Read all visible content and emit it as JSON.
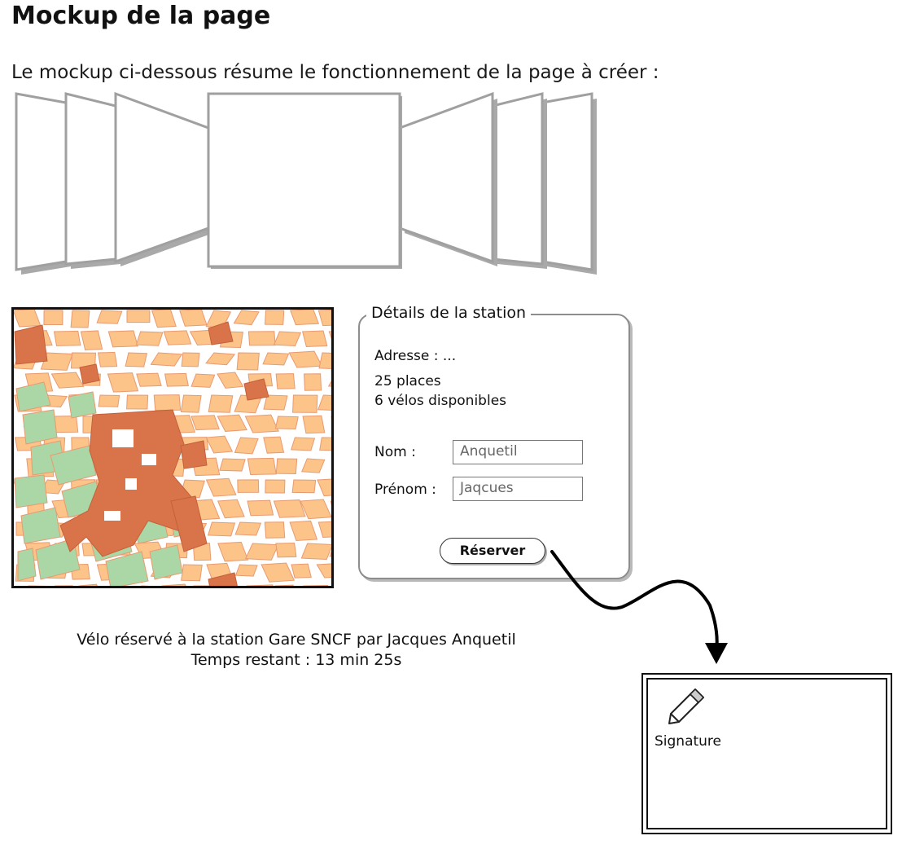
{
  "page": {
    "title": "Mockup de la page",
    "intro": "Le mockup ci-dessous résume le fonctionnement de la page à créer :"
  },
  "details": {
    "legend": "Détails de la station",
    "address": "Adresse :  ...",
    "places": "25 places",
    "bikes": "6 vélos disponibles",
    "name_label": "Nom :",
    "name_value": "Anquetil",
    "firstname_label": "Prénom :",
    "firstname_value": "Jaqcues",
    "reserve_label": "Réserver"
  },
  "confirmation": {
    "line1": "Vélo réservé à la station Gare SNCF par Jacques Anquetil",
    "line2": "Temps restant : 13 min 25s"
  },
  "signature": {
    "label": "Signature",
    "icon": "pencil-icon"
  },
  "colors": {
    "map_block": "#fdc48a",
    "map_landmark": "#d9734a",
    "map_park": "#abd7a6",
    "map_edge": "#e89a70",
    "box_border": "#8d8d8d"
  }
}
